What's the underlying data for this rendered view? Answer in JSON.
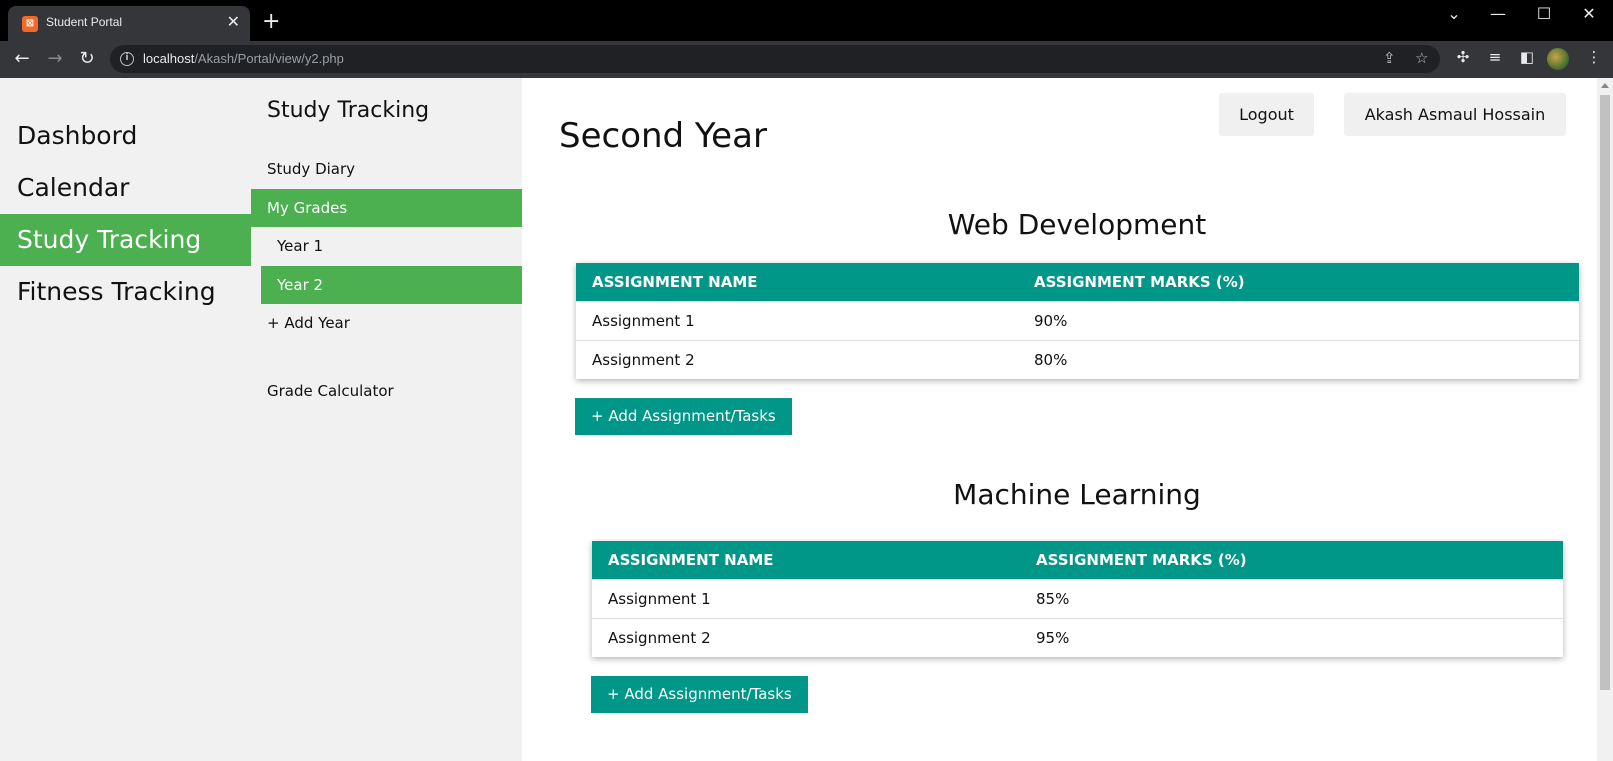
{
  "browser": {
    "tab_title": "Student Portal",
    "url_host": "localhost",
    "url_path": "/Akash/Portal/view/y2.php"
  },
  "sidenav": {
    "items": [
      {
        "label": "Dashbord",
        "active": false
      },
      {
        "label": "Calendar",
        "active": false
      },
      {
        "label": "Study Tracking",
        "active": true
      },
      {
        "label": "Fitness Tracking",
        "active": false
      }
    ]
  },
  "subnav": {
    "title": "Study Tracking",
    "study_diary": "Study Diary",
    "my_grades": "My Grades",
    "year1": "Year 1",
    "year2": "Year 2",
    "add_year": "+ Add Year",
    "grade_calculator": "Grade Calculator"
  },
  "header": {
    "logout_label": "Logout",
    "user_label": "Akash Asmaul Hossain"
  },
  "page_title": "Second Year",
  "modules": [
    {
      "title": "Web Development",
      "col_name": "ASSIGNMENT NAME",
      "col_marks": "ASSIGNMENT MARKS (%)",
      "rows": [
        {
          "name": "Assignment 1",
          "marks": "90%"
        },
        {
          "name": "Assignment 2",
          "marks": "80%"
        }
      ],
      "add_label": "+ Add Assignment/Tasks"
    },
    {
      "title": "Machine Learning",
      "col_name": "ASSIGNMENT NAME",
      "col_marks": "ASSIGNMENT MARKS (%)",
      "rows": [
        {
          "name": "Assignment 1",
          "marks": "85%"
        },
        {
          "name": "Assignment 2",
          "marks": "95%"
        }
      ],
      "add_label": "+ Add Assignment/Tasks"
    }
  ],
  "colors": {
    "active_green": "#4caf50",
    "table_teal": "#009688"
  }
}
